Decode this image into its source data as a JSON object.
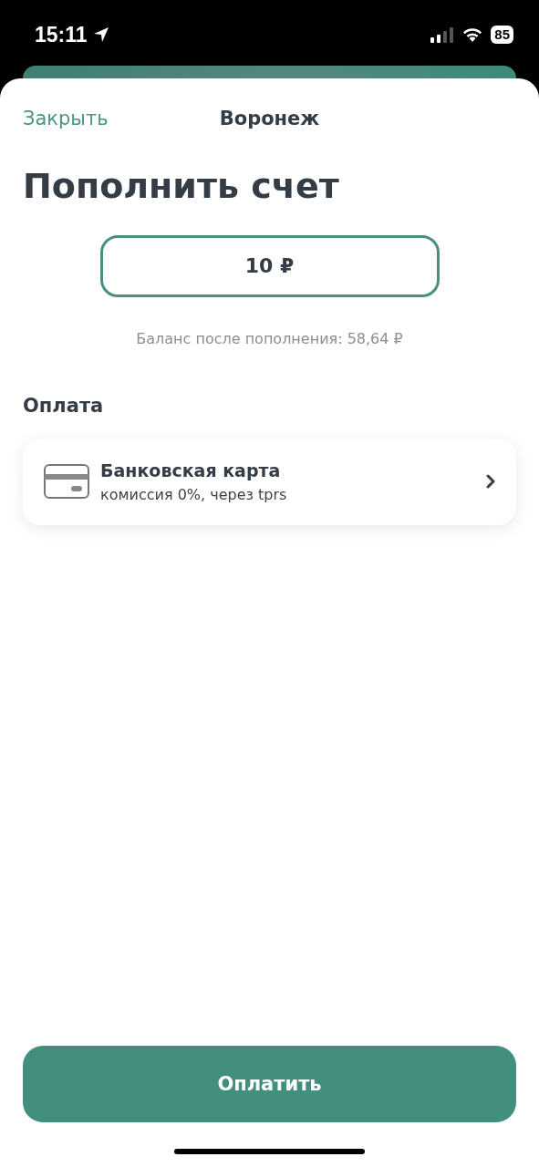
{
  "status_bar": {
    "time": "15:11",
    "battery": "85"
  },
  "header": {
    "close": "Закрыть",
    "city": "Воронеж"
  },
  "title": "Пополнить счет",
  "amount_field": {
    "value": "10 ₽"
  },
  "balance_note": "Баланс после пополнения: 58,64 ₽",
  "payment": {
    "heading": "Оплата",
    "methods": [
      {
        "kind": "card",
        "title": "Банковская карта",
        "subtitle": "комиссия 0%, через tprs"
      }
    ]
  },
  "pay_button": "Оплатить"
}
